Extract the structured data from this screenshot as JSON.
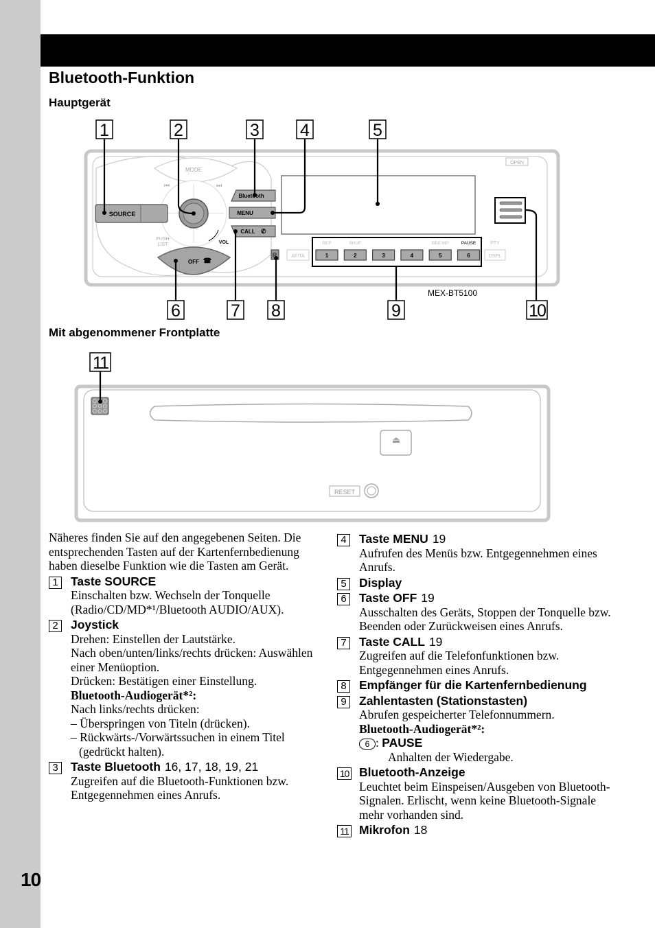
{
  "page": {
    "title": "Bluetooth-Funktion",
    "page_number": "10",
    "section_main_unit": "Hauptgerät",
    "section_front_removed": "Mit abgenommener Frontplatte"
  },
  "diagram_main": {
    "model": "MEX-BT5100",
    "callouts": [
      "1",
      "2",
      "3",
      "4",
      "5",
      "6",
      "7",
      "8",
      "9",
      "10"
    ],
    "labels": {
      "source": "SOURCE",
      "mode": "MODE",
      "prev": "⏮",
      "next": "⏭",
      "push_list": [
        "PUSH",
        "LIST"
      ],
      "vol": "VOL",
      "off": "OFF",
      "bluetooth": "Bluetooth",
      "menu": "MENU",
      "call": "CALL",
      "open": "OPEN",
      "af_ta": "AF/TA",
      "dspl": "DSPL",
      "remote_sensor": "R",
      "preset_top_labels": [
        "REP",
        "SHUF",
        "",
        "",
        "BBE MP",
        "PAUSE"
      ],
      "pty": "PTY",
      "presets": [
        "1",
        "2",
        "3",
        "4",
        "5",
        "6"
      ]
    }
  },
  "diagram_front_removed": {
    "callouts": [
      "11"
    ],
    "labels": {
      "reset": "RESET",
      "eject": "⏏"
    }
  },
  "intro": "Näheres finden Sie auf den angegebenen Seiten. Die entsprechenden Tasten auf der Kartenfernbedienung haben dieselbe Funktion wie die Tasten am Gerät.",
  "items": [
    {
      "num": "1",
      "title": "Taste SOURCE",
      "pages": "",
      "desc": [
        "Einschalten bzw. Wechseln der Tonquelle (Radio/CD/MD*¹/Bluetooth AUDIO/AUX)."
      ]
    },
    {
      "num": "2",
      "title": "Joystick",
      "pages": "",
      "desc": [
        "Drehen: Einstellen der Lautstärke.",
        "Nach oben/unten/links/rechts drücken: Auswählen einer Menüoption.",
        "Drücken: Bestätigen einer Einstellung."
      ],
      "bt_heading": "Bluetooth-Audiogerät*²:",
      "bt_intro": "Nach links/rechts drücken:",
      "bt_list": [
        "– Überspringen von Titeln (drücken).",
        "– Rückwärts-/Vorwärtssuchen in einem Titel (gedrückt halten)."
      ]
    },
    {
      "num": "3",
      "title": "Taste Bluetooth",
      "pages": "16, 17, 18, 19, 21",
      "desc": [
        "Zugreifen auf die Bluetooth-Funktionen bzw. Entgegennehmen eines Anrufs."
      ]
    },
    {
      "num": "4",
      "title": "Taste MENU",
      "pages": "19",
      "desc": [
        "Aufrufen des Menüs bzw. Entgegennehmen eines Anrufs."
      ]
    },
    {
      "num": "5",
      "title": "Display",
      "pages": "",
      "desc": []
    },
    {
      "num": "6",
      "title": "Taste OFF",
      "pages": "19",
      "desc": [
        "Ausschalten des Geräts, Stoppen der Tonquelle bzw. Beenden oder Zurückweisen eines Anrufs."
      ]
    },
    {
      "num": "7",
      "title": "Taste CALL",
      "pages": "19",
      "desc": [
        "Zugreifen auf die Telefonfunktionen bzw. Entgegennehmen eines Anrufs."
      ]
    },
    {
      "num": "8",
      "title": "Empfänger für die Kartenfernbedienung",
      "pages": "",
      "desc": []
    },
    {
      "num": "9",
      "title": "Zahlentasten (Stationstasten)",
      "pages": "",
      "desc": [
        "Abrufen gespeicherter Telefonnummern."
      ],
      "bt_heading": "Bluetooth-Audiogerät*²:",
      "pause_key": "6",
      "pause_label": "PAUSE",
      "pause_desc": "Anhalten der Wiedergabe."
    },
    {
      "num": "10",
      "title": "Bluetooth-Anzeige",
      "pages": "",
      "desc": [
        "Leuchtet beim Einspeisen/Ausgeben von Bluetooth-Signalen. Erlischt, wenn keine Bluetooth-Signale mehr vorhanden sind."
      ]
    },
    {
      "num": "11",
      "title": "Mikrofon",
      "pages": "18",
      "desc": []
    }
  ]
}
